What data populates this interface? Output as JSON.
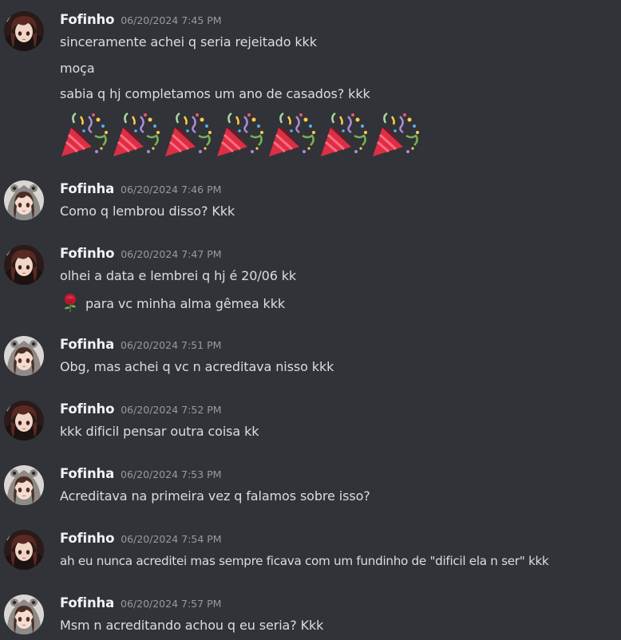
{
  "users": {
    "fofinho": {
      "name": "Fofinho",
      "avatar_icon": "anime-avatar-brown-hair-icon"
    },
    "fofinha": {
      "name": "Fofinha",
      "avatar_icon": "anime-avatar-gray-hood-icon"
    }
  },
  "messages": [
    {
      "author": "Fofinho",
      "timestamp": "06/20/2024 7:45 PM",
      "lines": [
        "sinceramente achei q seria rejeitado kkk",
        "moça",
        "sabia q hj completamos um ano de casados? kkk"
      ],
      "emoji": "party-popper-icon",
      "emoji_count": 7
    },
    {
      "author": "Fofinha",
      "timestamp": "06/20/2024 7:46 PM",
      "lines": [
        "Como q lembrou disso? Kkk"
      ]
    },
    {
      "author": "Fofinho",
      "timestamp": "06/20/2024 7:47 PM",
      "lines": [
        "olhei a data e lembrei q hj é 20/06 kk",
        "para vc minha alma gêmea kkk"
      ],
      "inline_emoji": "rose-icon"
    },
    {
      "author": "Fofinha",
      "timestamp": "06/20/2024 7:51 PM",
      "lines": [
        "Obg, mas achei q vc n acreditava nisso kkk"
      ]
    },
    {
      "author": "Fofinho",
      "timestamp": "06/20/2024 7:52 PM",
      "lines": [
        "kkk dificil pensar outra coisa kk"
      ]
    },
    {
      "author": "Fofinha",
      "timestamp": "06/20/2024 7:53 PM",
      "lines": [
        "Acreditava na primeira vez q falamos sobre isso?"
      ]
    },
    {
      "author": "Fofinho",
      "timestamp": "06/20/2024 7:54 PM",
      "lines": [
        "ah eu nunca acreditei mas sempre ficava com um fundinho de \"dificil ela n ser\" kkk"
      ]
    },
    {
      "author": "Fofinha",
      "timestamp": "06/20/2024 7:57 PM",
      "lines": [
        "Msm n acreditando achou q eu seria? Kkk"
      ]
    }
  ],
  "theme": {
    "background": "#313338",
    "author_color": "#f2f3f5",
    "timestamp_color": "#949ba4",
    "text_color": "#dbdee1"
  }
}
